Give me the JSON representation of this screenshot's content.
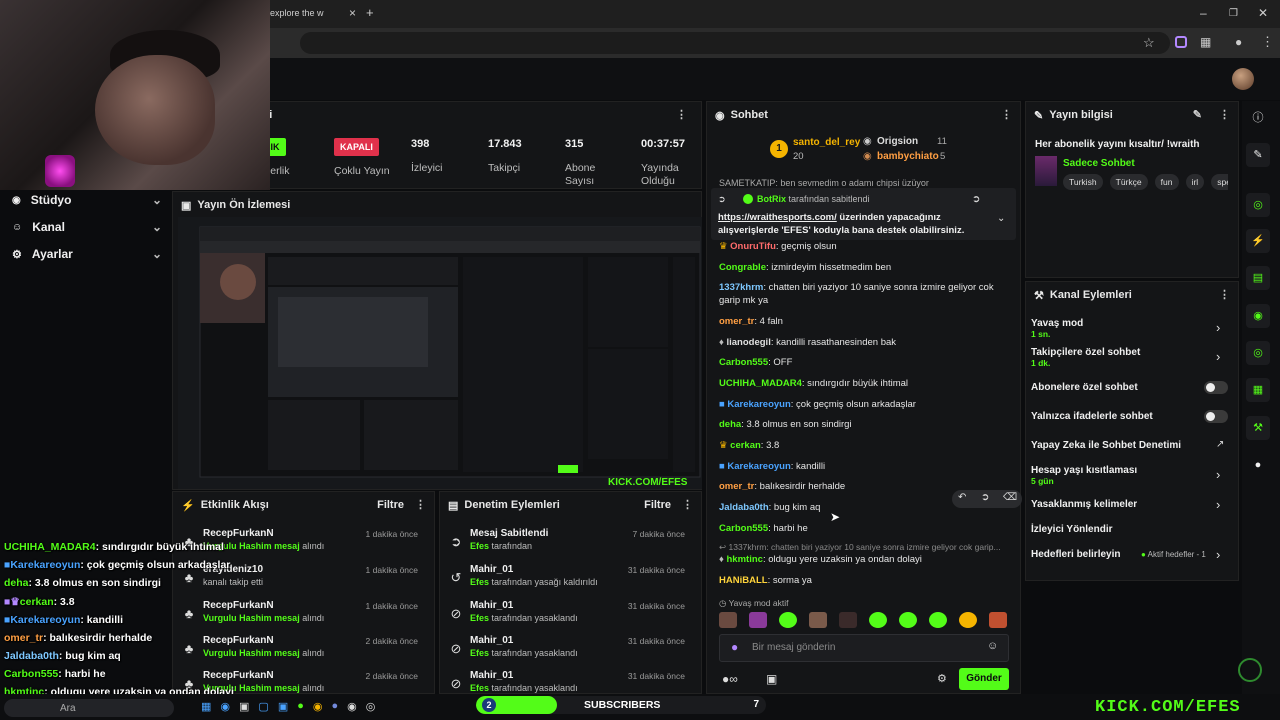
{
  "browser": {
    "tab_title": "explore the w",
    "close_glyph": "×",
    "new_tab_glyph": "+"
  },
  "nav": {
    "items": [
      {
        "label": "Stüdyo",
        "icon": "studio-icon"
      },
      {
        "label": "Kanal",
        "icon": "channel-icon"
      },
      {
        "label": "Ayarlar",
        "icon": "gear-icon"
      }
    ]
  },
  "stats": {
    "partner_pill": "ÇIK",
    "partner_label": "rtnerlik",
    "multichat_pill": "KAPALI",
    "multichat_label": "Çoklu Yayın",
    "viewers": "398",
    "viewers_label": "İzleyici",
    "followers": "17.843",
    "followers_label": "Takipçi",
    "subs": "315",
    "subs_label": "Abone Sayısı",
    "uptime": "00:37:57",
    "uptime_label": "Yayında Olduğu",
    "panel_title_tail": "ri"
  },
  "preview": {
    "title": "Yayın Ön İzlemesi"
  },
  "activity": {
    "title": "Etkinlik Akışı",
    "filter": "Filtre",
    "items": [
      {
        "name": "RecepFurkanN",
        "sub_hl": "Vurgulu Hashim mesaj",
        "sub_rest": " alındı",
        "time": "1 dakika önce"
      },
      {
        "name": "erayldeniz10",
        "sub_hl": "",
        "sub_rest": "kanalı takip etti",
        "time": "1 dakika önce"
      },
      {
        "name": "RecepFurkanN",
        "sub_hl": "Vurgulu Hashim mesaj",
        "sub_rest": " alındı",
        "time": "1 dakika önce"
      },
      {
        "name": "RecepFurkanN",
        "sub_hl": "Vurgulu Hashim mesaj",
        "sub_rest": " alındı",
        "time": "2 dakika önce"
      },
      {
        "name": "RecepFurkanN",
        "sub_hl": "Vurgulu Hashim mesaj",
        "sub_rest": " alındı",
        "time": "2 dakika önce"
      }
    ]
  },
  "moderation": {
    "title": "Denetim Eylemleri",
    "filter": "Filtre",
    "items": [
      {
        "name": "Mesaj Sabitlendi",
        "who": "Efes",
        "rest": " tarafından",
        "time": "7 dakika önce",
        "icon": "pin-icon"
      },
      {
        "name": "Mahir_01",
        "who": "Efes",
        "rest": " tarafından yasağı kaldırıldı",
        "time": "31 dakika önce",
        "icon": "undo-icon"
      },
      {
        "name": "Mahir_01",
        "who": "Efes",
        "rest": " tarafından yasaklandı",
        "time": "31 dakika önce",
        "icon": "ban-icon"
      },
      {
        "name": "Mahir_01",
        "who": "Efes",
        "rest": " tarafından yasaklandı",
        "time": "31 dakika önce",
        "icon": "ban-icon"
      },
      {
        "name": "Mahir_01",
        "who": "Efes",
        "rest": " tarafından yasaklandı",
        "time": "31 dakika önce",
        "icon": "ban-icon"
      }
    ]
  },
  "chat": {
    "title": "Sohbet",
    "top_gifter": {
      "name": "santo_del_rey",
      "count": "20",
      "rank": "1"
    },
    "second": {
      "name": "Origsion",
      "count": "11"
    },
    "third": {
      "name": "bambychiato",
      "count": "5"
    },
    "cut_line": "SAMETKATIP: ben sevmedim o adamı chipsi üzüyor",
    "pinned_by": "BotRix",
    "pinned_by_rest": " tarafından sabitlendi",
    "pinned_link": "https://wraithesports.com/",
    "pinned_text": " üzerinden yapacağınız alışverişlerde 'EFES' koduyla bana destek olabilirsiniz.",
    "messages": [
      {
        "user": "OnuruTifu",
        "color": "#ff6b6b",
        "text": "geçmiş olsun"
      },
      {
        "user": "Congrable",
        "color": "#53fc18",
        "text": "izmirdeyim hissetmedim ben"
      },
      {
        "user": "1337khrm",
        "color": "#7ec8ff",
        "text": "chatten biri yaziyor 10 saniye sonra izmire geliyor cok garip mk ya"
      },
      {
        "user": "omer_tr",
        "color": "#ff9f43",
        "text": "4 faln"
      },
      {
        "user": "lianodegil",
        "color": "#e0e0e0",
        "text": "kandilli rasathanesinden bak"
      },
      {
        "user": "Carbon555",
        "color": "#53fc18",
        "text": "OFF"
      },
      {
        "user": "UCHIHA_MADAR4",
        "color": "#53fc18",
        "text": "sındırgıdır büyük ihtimal"
      },
      {
        "user": "Karekareoyun",
        "color": "#4aa3ff",
        "text": "çok geçmiş olsun arkadaşlar"
      },
      {
        "user": "deha",
        "color": "#53fc18",
        "text": "3.8 olmus en son sindirgi"
      },
      {
        "user": "cerkan",
        "color": "#53fc18",
        "text": "3.8"
      },
      {
        "user": "Karekareoyun",
        "color": "#4aa3ff",
        "text": "kandilli"
      },
      {
        "user": "omer_tr",
        "color": "#ff9f43",
        "text": "balıkesirdir herhalde"
      },
      {
        "user": "Jaldaba0th",
        "color": "#7ec8ff",
        "text": "bug kim aq"
      },
      {
        "user": "Carbon555",
        "color": "#53fc18",
        "text": "harbi he"
      }
    ],
    "reply_ref": "1337khrm: chatten biri yaziyor 10 saniye sonra izmire geliyor cok garip...",
    "reply_msg": {
      "user": "hkmtinc",
      "color": "#53fc18",
      "text": "oldugu yere uzaksin ya ondan dolayi"
    },
    "last_msg": {
      "user": "HANiBALL",
      "color": "#ffd43b",
      "text": "sorma ya"
    },
    "slow_mode": "Yavaş mod aktif",
    "input_placeholder": "Bir mesaj gönderin",
    "send": "Gönder"
  },
  "stream_info": {
    "title": "Yayın bilgisi",
    "stream_title": "Her abonelik yayını kısaltır/ !wraith",
    "category": "Sadece Sohbet",
    "tags": [
      "Turkish",
      "Türkçe",
      "fun",
      "irl",
      "spe"
    ]
  },
  "channel_actions": {
    "title": "Kanal Eylemleri",
    "items": [
      {
        "label": "Yavaş mod",
        "sub": "1 sn.",
        "kind": "chevron"
      },
      {
        "label": "Takipçilere özel sohbet",
        "sub": "1 dk.",
        "kind": "chevron"
      },
      {
        "label": "Abonelere özel sohbet",
        "sub": "",
        "kind": "toggle"
      },
      {
        "label": "Yalnızca ifadelerle sohbet",
        "sub": "",
        "kind": "toggle"
      },
      {
        "label": "Yapay Zeka ile Sohbet Denetimi",
        "sub": "",
        "kind": "external"
      },
      {
        "label": "Hesap yaşı kısıtlaması",
        "sub": "5 gün",
        "kind": "chevron"
      },
      {
        "label": "Yasaklanmış kelimeler",
        "sub": "",
        "kind": "chevron"
      },
      {
        "label": "İzleyici Yönlendir",
        "sub": "",
        "kind": "none"
      },
      {
        "label": "Hedefleri belirleyin",
        "sub": "",
        "kind": "goal"
      }
    ],
    "goal_badge": "Aktif hedefler - 1"
  },
  "overlay_chat": [
    {
      "user": "UCHIHA_MADAR4",
      "color": "#53fc18",
      "text": ": sındırgıdır büyük ihtimal"
    },
    {
      "user": "Karekareoyun",
      "color": "#4aa3ff",
      "text": ": çok geçmiş olsun arkadaşlar"
    },
    {
      "user": "deha",
      "color": "#53fc18",
      "text": ": 3.8 olmus en son sindirgi"
    },
    {
      "user": "cerkan",
      "color": "#53fc18",
      "text": ": 3.8"
    },
    {
      "user": "Karekareoyun",
      "color": "#4aa3ff",
      "text": ": kandilli"
    },
    {
      "user": "omer_tr",
      "color": "#ff9f43",
      "text": ": balıkesirdir herhalde"
    },
    {
      "user": "Jaldaba0th",
      "color": "#7ec8ff",
      "text": ": bug kim aq"
    },
    {
      "user": "Carbon555",
      "color": "#53fc18",
      "text": ": harbi he"
    },
    {
      "user": "hkmtinc",
      "color": "#53fc18",
      "text": ": oldugu yere uzaksin ya ondan dolayi"
    }
  ],
  "taskbar": {
    "search_placeholder": "Ara",
    "sub_goal_count": "2",
    "sub_goal_label": "SUBSCRIBERS",
    "sub_goal_target": "7",
    "sub_goal_fill": 0.28,
    "watermark": "KICK.COM/EFES"
  },
  "colors": {
    "accent": "#53fc18",
    "live_red": "#e0314b",
    "gold": "#f5b400"
  }
}
